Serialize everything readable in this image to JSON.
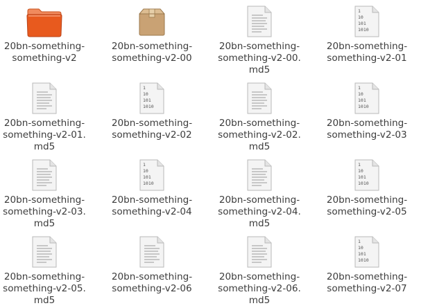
{
  "file_manager": {
    "items": [
      {
        "type": "folder",
        "icon": "folder-icon",
        "line1": "20bn-something-",
        "line2": "something-v2",
        "line3": ""
      },
      {
        "type": "archive",
        "icon": "archive-box-icon",
        "line1": "20bn-something-",
        "line2": "something-v2-00",
        "line3": ""
      },
      {
        "type": "text",
        "icon": "text-file-icon",
        "line1": "20bn-something-",
        "line2": "something-v2-00.",
        "line3": "md5"
      },
      {
        "type": "binary",
        "icon": "binary-file-icon",
        "line1": "20bn-something-",
        "line2": "something-v2-01",
        "line3": ""
      },
      {
        "type": "text",
        "icon": "text-file-icon",
        "line1": "20bn-something-",
        "line2": "something-v2-01.",
        "line3": "md5"
      },
      {
        "type": "binary",
        "icon": "binary-file-icon",
        "line1": "20bn-something-",
        "line2": "something-v2-02",
        "line3": ""
      },
      {
        "type": "text",
        "icon": "text-file-icon",
        "line1": "20bn-something-",
        "line2": "something-v2-02.",
        "line3": "md5"
      },
      {
        "type": "binary",
        "icon": "binary-file-icon",
        "line1": "20bn-something-",
        "line2": "something-v2-03",
        "line3": ""
      },
      {
        "type": "text",
        "icon": "text-file-icon",
        "line1": "20bn-something-",
        "line2": "something-v2-03.",
        "line3": "md5"
      },
      {
        "type": "binary",
        "icon": "binary-file-icon",
        "line1": "20bn-something-",
        "line2": "something-v2-04",
        "line3": ""
      },
      {
        "type": "text",
        "icon": "text-file-icon",
        "line1": "20bn-something-",
        "line2": "something-v2-04.",
        "line3": "md5"
      },
      {
        "type": "binary",
        "icon": "binary-file-icon",
        "line1": "20bn-something-",
        "line2": "something-v2-05",
        "line3": ""
      },
      {
        "type": "text",
        "icon": "text-file-icon",
        "line1": "20bn-something-",
        "line2": "something-v2-05.",
        "line3": "md5"
      },
      {
        "type": "text",
        "icon": "text-file-icon",
        "line1": "20bn-something-",
        "line2": "something-v2-06",
        "line3": ""
      },
      {
        "type": "text",
        "icon": "text-file-icon",
        "line1": "20bn-something-",
        "line2": "something-v2-06.",
        "line3": "md5"
      },
      {
        "type": "binary",
        "icon": "binary-file-icon",
        "line1": "20bn-something-",
        "line2": "something-v2-07",
        "line3": ""
      }
    ],
    "binary_glyph_lines": [
      "1",
      "10",
      "101",
      "1010"
    ],
    "colors": {
      "folder_top": "#f08a5d",
      "folder_body": "#e85a1e",
      "archive": "#c9a274",
      "paper": "#f4f4f4",
      "paper_border": "#b9b9b9",
      "text": "#3c3c3c"
    }
  }
}
